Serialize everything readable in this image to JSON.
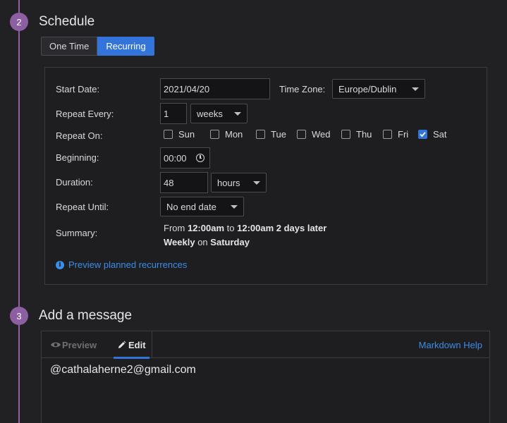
{
  "step2": {
    "number": "2",
    "title": "Schedule",
    "segments": {
      "one_time": "One Time",
      "recurring": "Recurring",
      "active": "Recurring"
    }
  },
  "form": {
    "start_date_label": "Start Date:",
    "start_date_value": "2021/04/20",
    "time_zone_label": "Time Zone:",
    "time_zone_value": "Europe/Dublin",
    "repeat_every_label": "Repeat Every:",
    "repeat_every_value": "1",
    "repeat_every_unit": "weeks",
    "repeat_on_label": "Repeat On:",
    "days": [
      {
        "label": "Sun",
        "checked": false
      },
      {
        "label": "Mon",
        "checked": false
      },
      {
        "label": "Tue",
        "checked": false
      },
      {
        "label": "Wed",
        "checked": false
      },
      {
        "label": "Thu",
        "checked": false
      },
      {
        "label": "Fri",
        "checked": false
      },
      {
        "label": "Sat",
        "checked": true
      }
    ],
    "beginning_label": "Beginning:",
    "beginning_value": "00:00",
    "duration_label": "Duration:",
    "duration_value": "48",
    "duration_unit": "hours",
    "repeat_until_label": "Repeat Until:",
    "repeat_until_value": "No end date",
    "summary_label": "Summary:",
    "summary": {
      "from": "From",
      "start": "12:00am",
      "to": "to",
      "end": "12:00am 2 days later",
      "freq": "Weekly",
      "on": "on",
      "day": "Saturday"
    },
    "preview_link": "Preview planned recurrences"
  },
  "step3": {
    "number": "3",
    "title": "Add a message",
    "tabs": {
      "preview": "Preview",
      "edit": "Edit"
    },
    "markdown_help": "Markdown Help",
    "message": "@cathalaherne2@gmail.com"
  },
  "colors": {
    "accent": "#3274d9",
    "step": "#8e5ea2",
    "link": "#3a8de8"
  }
}
